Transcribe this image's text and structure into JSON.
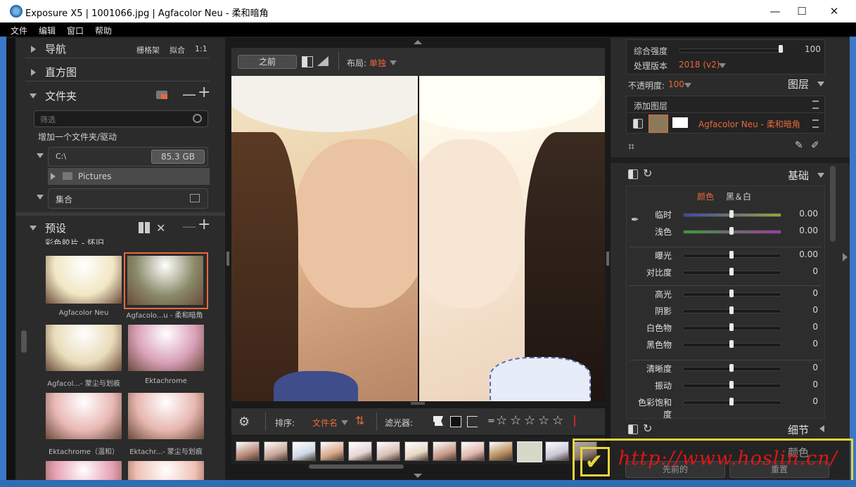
{
  "window": {
    "title": "Exposure X5 | 1001066.jpg | Agfacolor Neu - 柔和暗角",
    "minimize": "—",
    "maximize": "☐",
    "close": "✕"
  },
  "menu": [
    "文件",
    "编辑",
    "窗口",
    "帮助"
  ],
  "left": {
    "navigator": {
      "title": "导航",
      "opt1": "栅格架",
      "opt2": "拟合",
      "opt3": "1:1"
    },
    "histogram": {
      "title": "直方图"
    },
    "folders": {
      "title": "文件夹",
      "filter_placeholder": "筛选",
      "add_folder": "增加一个文件夹/驱动",
      "drive": "C:\\",
      "drive_size": "85.3 GB",
      "subfolder": "Pictures",
      "collections": "集合",
      "minus": "—",
      "plus": "+"
    },
    "presets": {
      "title": "预设",
      "group": "彩色胶片 - 怀旧",
      "items": [
        {
          "label": "Agfacolor Neu",
          "tint": "#f1e7c4"
        },
        {
          "label": "Agfacolo...u - 柔和暗角",
          "tint": "#8a8a6a"
        },
        {
          "label": "Agfacol...- 蒙尘与划痕",
          "tint": "#e9dcb9"
        },
        {
          "label": "Ektachrome",
          "tint": "#d9a0b8"
        },
        {
          "label": "Ektachrome（温和）",
          "tint": "#e8b8b4"
        },
        {
          "label": "Ektachr...- 蒙尘与划痕",
          "tint": "#e6b6ae"
        },
        {
          "label": "",
          "tint": "#e59fb0"
        },
        {
          "label": "",
          "tint": "#f0c0b4"
        }
      ]
    }
  },
  "center": {
    "before_btn": "之前",
    "layout_label": "布局:",
    "layout_value": "单独",
    "sort_label": "排序:",
    "sort_value": "文件名",
    "filter_label": "滤光器:",
    "filter_eq": "=",
    "stars": [
      "☆",
      "☆",
      "☆",
      "☆",
      "☆"
    ],
    "film_tints": [
      "#b88a7a",
      "#c9a79a",
      "#cfd9e6",
      "#d6a88a",
      "#e6d6d6",
      "#d9c1b6",
      "#e8d8c6",
      "#c99a8a",
      "#e0b8b0",
      "#b89060",
      "#9a9a7a",
      "#c9c9d9",
      "#d6b6a6"
    ]
  },
  "right": {
    "overall_strength_label": "综合强度",
    "overall_strength_value": "100",
    "process_label": "处理版本",
    "process_value": "2018 (v2)",
    "opacity_label": "不透明度:",
    "opacity_value": "100",
    "layers_title": "图层",
    "add_layer": "添加图层",
    "layer_name": "Agfacolor Neu - 柔和暗角",
    "basic_title": "基础",
    "color_tab": "颜色",
    "bw_tab": "黑＆白",
    "sliders": [
      {
        "label": "临时",
        "value": "0.00",
        "track": "linear-gradient(90deg,#3a4aa8,#9aa03a)"
      },
      {
        "label": "浅色",
        "value": "0.00",
        "track": "linear-gradient(90deg,#3a9a3a,#a03aa0)"
      },
      {
        "label": "曝光",
        "value": "0.00",
        "track": "#1a1a1a"
      },
      {
        "label": "对比度",
        "value": "0",
        "track": "#1a1a1a"
      },
      {
        "label": "高光",
        "value": "0",
        "track": "#1a1a1a"
      },
      {
        "label": "阴影",
        "value": "0",
        "track": "#1a1a1a"
      },
      {
        "label": "白色物",
        "value": "0",
        "track": "#1a1a1a"
      },
      {
        "label": "黑色物",
        "value": "0",
        "track": "#1a1a1a"
      },
      {
        "label": "清晰度",
        "value": "0",
        "track": "#1a1a1a"
      },
      {
        "label": "振动",
        "value": "0",
        "track": "#1a1a1a"
      },
      {
        "label": "色彩饱和度",
        "value": "0",
        "track": "#1a1a1a"
      }
    ],
    "detail_title": "细节",
    "color_title": "颜色",
    "prev_btn": "先前的",
    "reset_btn": "重置"
  },
  "watermark": {
    "text": "http://www.hoslin.cn/"
  }
}
